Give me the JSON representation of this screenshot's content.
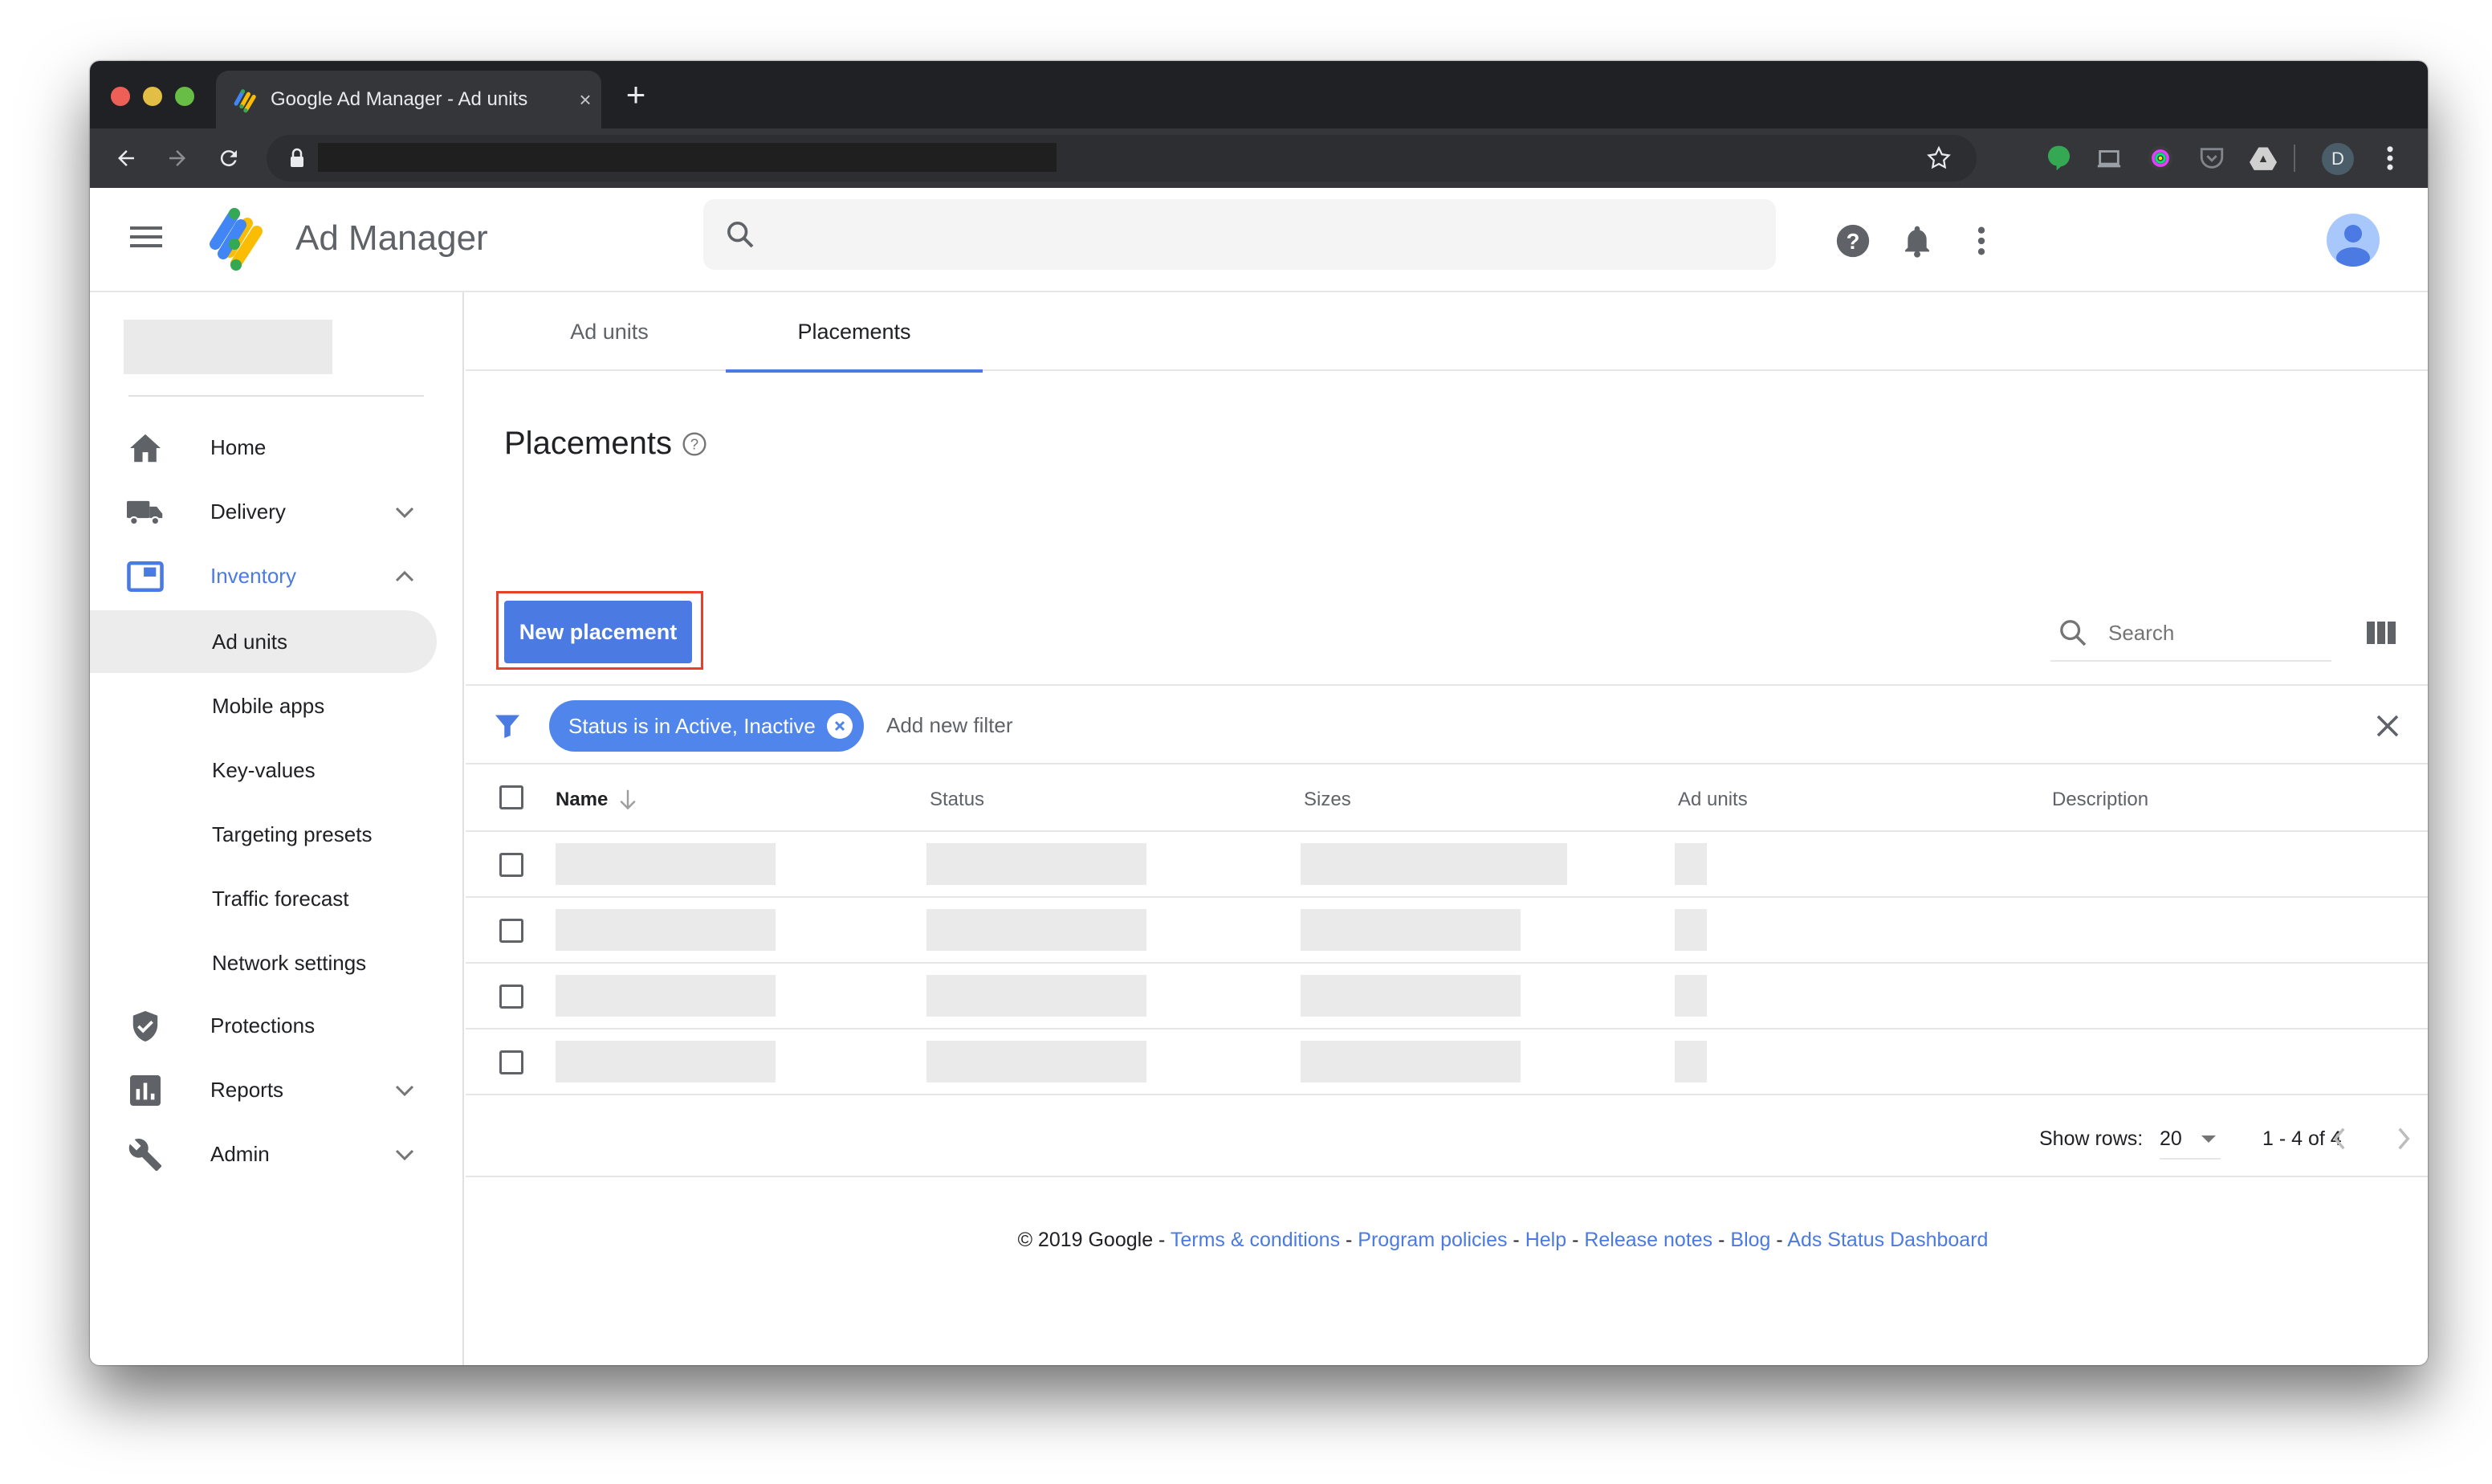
{
  "browser": {
    "tab_title": "Google Ad Manager - Ad units",
    "tab_close": "×",
    "new_tab": "+",
    "profile_initial": "D",
    "extensions": [
      "hangouts-icon",
      "cast-icon",
      "color-picker-icon",
      "pocket-icon",
      "google-drive-icon"
    ]
  },
  "header": {
    "brand": "Ad Manager",
    "search_placeholder": "",
    "colors": {
      "accent": "#4a7ae2",
      "chip": "#5086ec"
    }
  },
  "sidebar": {
    "items": [
      {
        "label": "Home",
        "icon": "home-icon",
        "expandable": false
      },
      {
        "label": "Delivery",
        "icon": "truck-icon",
        "expandable": true,
        "expanded": false
      },
      {
        "label": "Inventory",
        "icon": "inventory-icon",
        "expandable": true,
        "expanded": true,
        "active": true
      },
      {
        "label": "Protections",
        "icon": "shield-check-icon",
        "expandable": false
      },
      {
        "label": "Reports",
        "icon": "bar-chart-icon",
        "expandable": true,
        "expanded": false
      },
      {
        "label": "Admin",
        "icon": "wrench-icon",
        "expandable": true,
        "expanded": false
      }
    ],
    "inventory_subitems": [
      {
        "label": "Ad units",
        "selected": true
      },
      {
        "label": "Mobile apps"
      },
      {
        "label": "Key-values"
      },
      {
        "label": "Targeting presets"
      },
      {
        "label": "Traffic forecast"
      },
      {
        "label": "Network settings"
      }
    ]
  },
  "main": {
    "tabs": [
      {
        "label": "Ad units",
        "active": false
      },
      {
        "label": "Placements",
        "active": true
      }
    ],
    "page_title": "Placements",
    "new_button": "New placement",
    "search_placeholder": "Search",
    "filter_chip": "Status is in Active, Inactive",
    "add_filter": "Add new filter",
    "table": {
      "columns": [
        "Name",
        "Status",
        "Sizes",
        "Ad units",
        "Description"
      ],
      "sort_column": "Name",
      "sort_direction": "descending",
      "rows": [
        {
          "loading": true
        },
        {
          "loading": true
        },
        {
          "loading": true
        },
        {
          "loading": true
        }
      ]
    },
    "pagination": {
      "show_rows_label": "Show rows:",
      "rows_per_page": "20",
      "range": "1 - 4 of 4"
    }
  },
  "footer": {
    "copyright": "© 2019 Google",
    "separator": " - ",
    "links": [
      "Terms & conditions",
      "Program policies",
      "Help",
      "Release notes",
      "Blog",
      "Ads Status Dashboard"
    ]
  }
}
